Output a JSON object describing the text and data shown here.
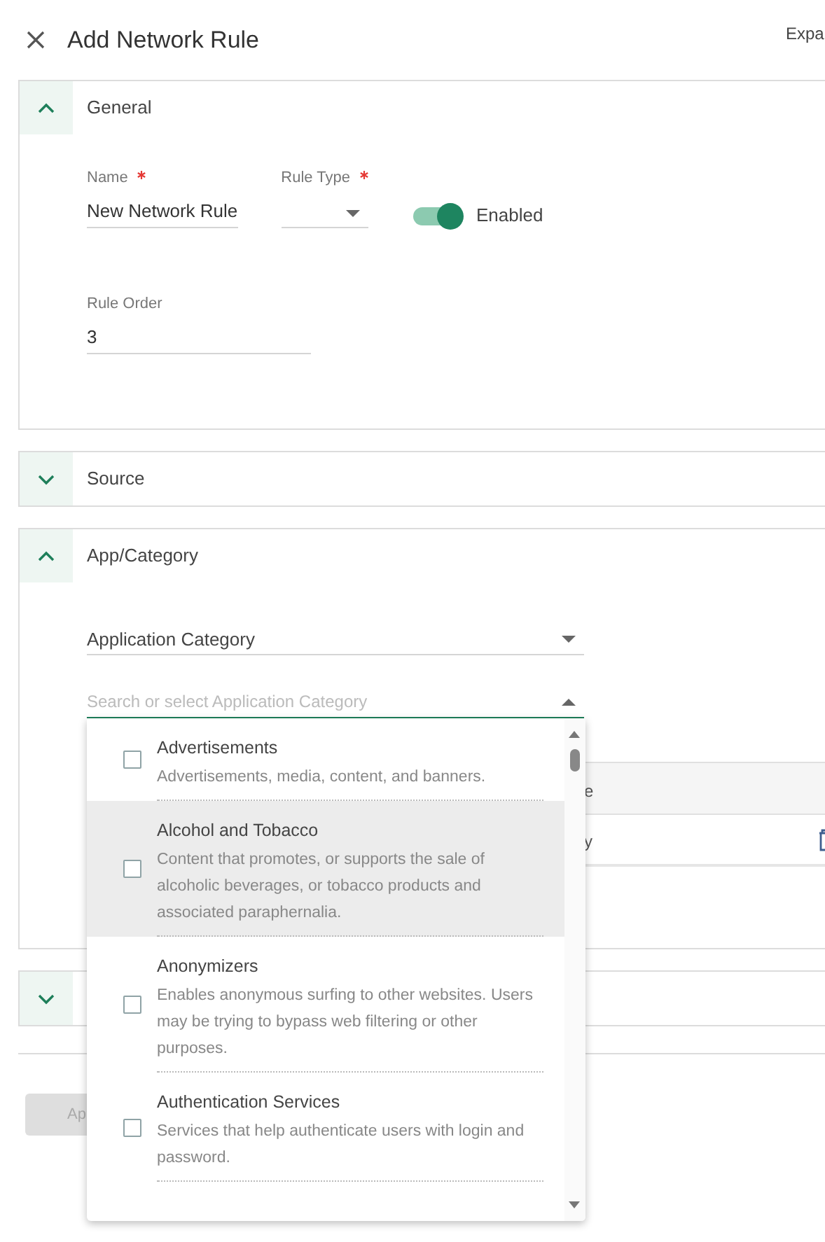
{
  "header": {
    "title": "Add Network Rule",
    "action": "Expa"
  },
  "sections": [
    {
      "label": "General",
      "expanded": true,
      "name_field": {
        "label": "Name",
        "required": true,
        "value": "New Network Rule"
      },
      "rule_type": {
        "label": "Rule Type",
        "required": true
      },
      "enabled_toggle": {
        "label": "Enabled",
        "on": true
      },
      "rule_order": {
        "label": "Rule Order",
        "value": "3"
      }
    },
    {
      "label": "Source",
      "expanded": false
    },
    {
      "label": "App/Category",
      "expanded": true,
      "select": {
        "value": "Application Category"
      },
      "search": {
        "placeholder": "Search or select Application Category"
      },
      "table": {
        "column_2": "e",
        "rows": [
          {
            "column_2": "y"
          }
        ]
      }
    },
    {
      "expanded": false
    }
  ],
  "apply_button": {
    "label": "Ap"
  },
  "dropdown": {
    "items": [
      {
        "title": "Advertisements",
        "description": "Advertisements, media, content, and banners.",
        "checked": false,
        "highlighted": false
      },
      {
        "title": "Alcohol and Tobacco",
        "description": "Content that promotes, or supports the sale of alcoholic beverages, or tobacco products and associated paraphernalia.",
        "checked": false,
        "highlighted": true
      },
      {
        "title": "Anonymizers",
        "description": "Enables anonymous surfing to other websites. Users may be trying to bypass web filtering or other purposes.",
        "checked": false,
        "highlighted": false
      },
      {
        "title": "Authentication Services",
        "description": "Services that help authenticate users with login and password.",
        "checked": false,
        "highlighted": false
      }
    ]
  }
}
